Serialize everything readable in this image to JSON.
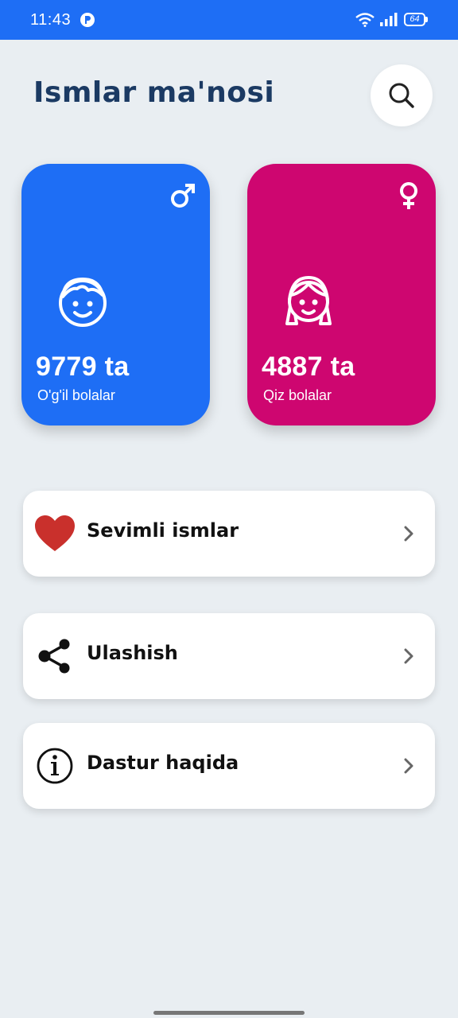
{
  "status_bar": {
    "time": "11:43",
    "battery_level": "64",
    "color": "#1e6ef5"
  },
  "header": {
    "title": "Ismlar ma'nosi",
    "search_icon": "search-icon"
  },
  "cards": {
    "boys": {
      "count": "9779 ta",
      "label": "O'g'il bolalar",
      "symbol_icon": "male-symbol-icon",
      "face_icon": "boy-face-icon",
      "color": "#1e6ef5"
    },
    "girls": {
      "count": "4887 ta",
      "label": "Qiz bolalar",
      "symbol_icon": "female-symbol-icon",
      "face_icon": "girl-face-icon",
      "color": "#ce0670"
    }
  },
  "menu": {
    "items": [
      {
        "label": "Sevimli ismlar",
        "icon": "heart-icon"
      },
      {
        "label": "Ulashish",
        "icon": "share-icon"
      },
      {
        "label": "Dastur haqida",
        "icon": "info-icon"
      }
    ]
  }
}
